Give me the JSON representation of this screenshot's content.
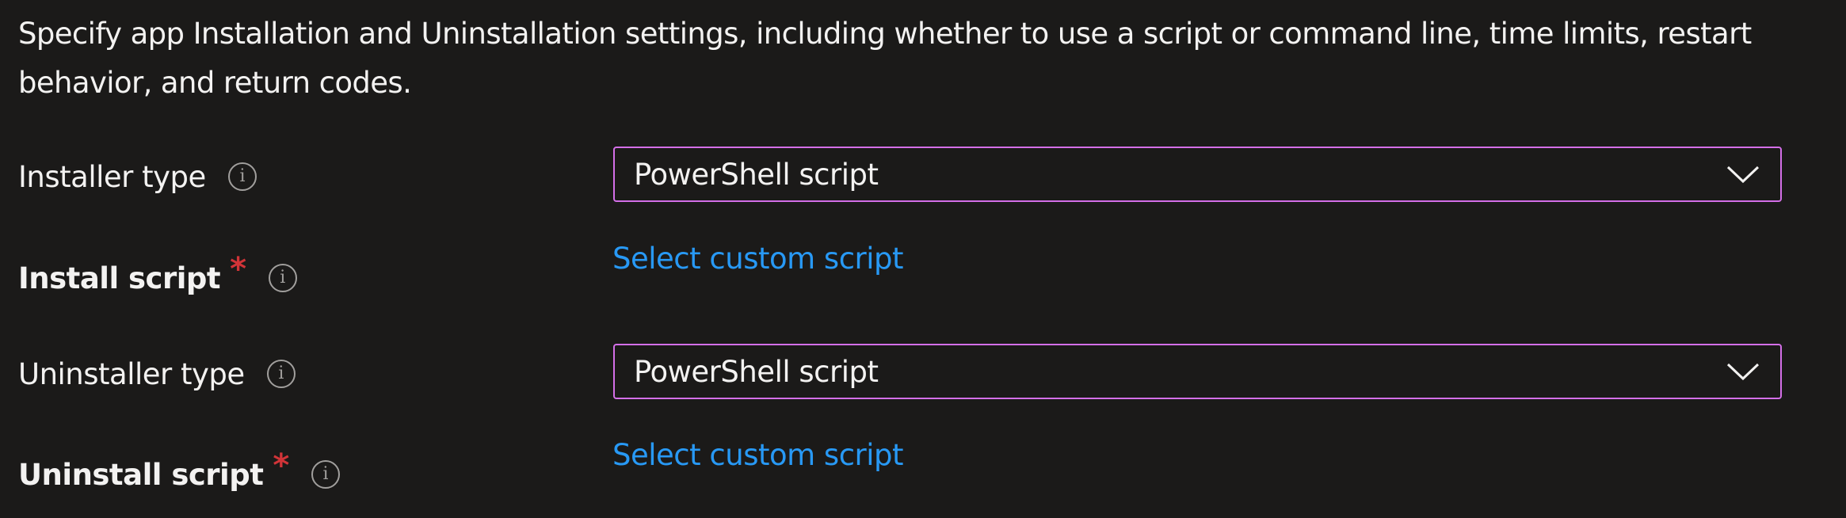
{
  "description": "Specify app Installation and Uninstallation settings, including whether to use a script or command line, time limits, restart behavior, and return codes.",
  "installer_type": {
    "label": "Installer type",
    "value": "PowerShell script"
  },
  "install_script": {
    "label": "Install script",
    "required_marker": "*",
    "link": "Select custom script"
  },
  "uninstaller_type": {
    "label": "Uninstaller type",
    "value": "PowerShell script"
  },
  "uninstall_script": {
    "label": "Uninstall script",
    "required_marker": "*",
    "link": "Select custom script"
  },
  "icons": {
    "info": "i",
    "info_name": "info-icon",
    "chevron_name": "chevron-down-icon"
  },
  "colors": {
    "background": "#1b1a19",
    "text": "#f3f2f1",
    "link": "#2899f5",
    "required": "#d13438",
    "focus_border": "#d46fe8"
  }
}
